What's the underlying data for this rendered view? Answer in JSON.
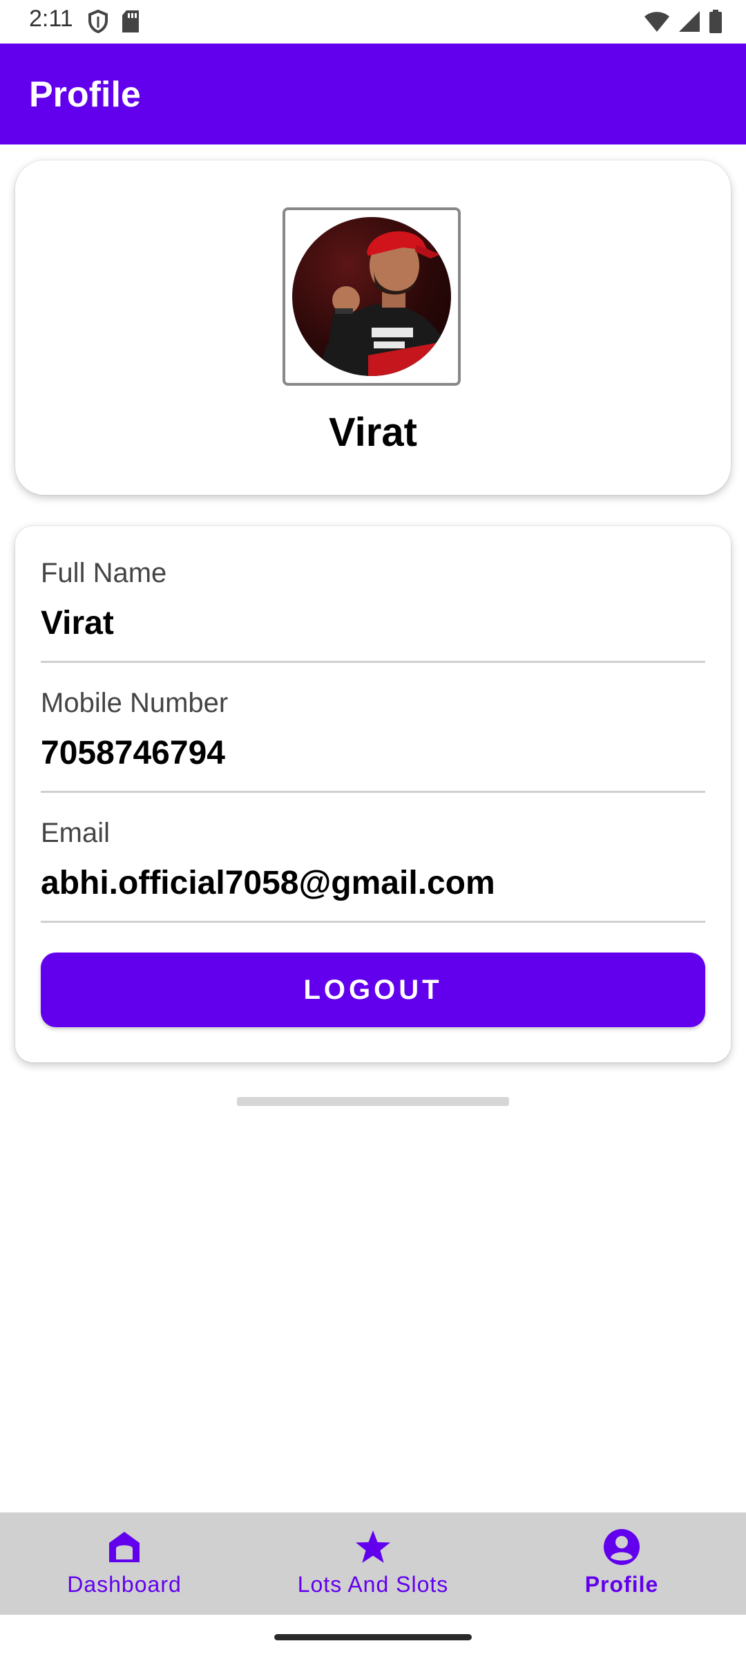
{
  "status_bar": {
    "time": "2:11"
  },
  "app_bar": {
    "title": "Profile"
  },
  "profile_header": {
    "name": "Virat"
  },
  "details": {
    "fields": [
      {
        "label": "Full Name",
        "value": "Virat"
      },
      {
        "label": "Mobile Number",
        "value": "7058746794"
      },
      {
        "label": "Email",
        "value": "abhi.official7058@gmail.com"
      }
    ],
    "logout_label": "LOGOUT"
  },
  "bottom_nav": {
    "items": [
      {
        "label": "Dashboard",
        "icon": "home-icon",
        "active": false
      },
      {
        "label": "Lots And Slots",
        "icon": "star-icon",
        "active": false
      },
      {
        "label": "Profile",
        "icon": "account-circle-icon",
        "active": true
      }
    ]
  },
  "colors": {
    "primary": "#6200ee",
    "nav_background": "#d0d0d0"
  }
}
